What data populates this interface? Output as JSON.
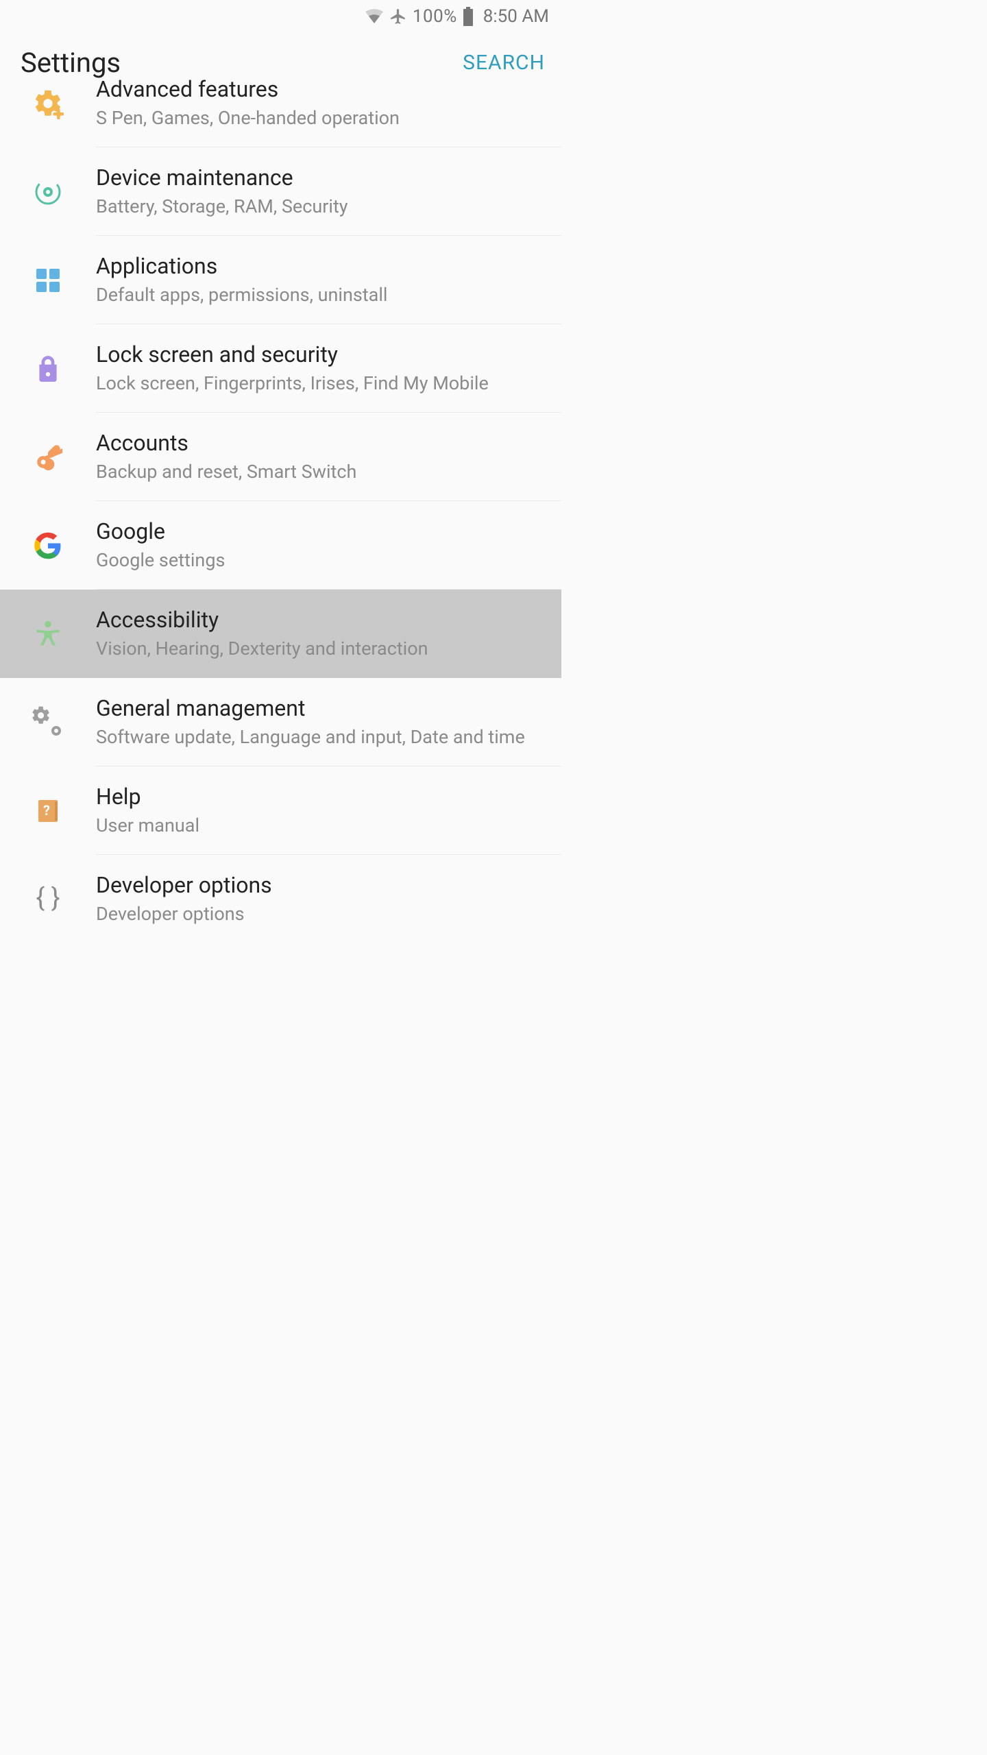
{
  "statusbar": {
    "battery_pct": "100%",
    "time": "8:50 AM"
  },
  "appbar": {
    "title": "Settings",
    "search_label": "SEARCH"
  },
  "colors": {
    "accent_search": "#2f9dbf",
    "advanced_icon": "#f4b64e",
    "maintenance_icon": "#54c1a4",
    "apps_icon": "#61b3e4",
    "lock_icon": "#a88ee5",
    "accounts_icon": "#f49b5e",
    "google_icon": "#4a86e0",
    "accessibility_icon": "#8fd08e",
    "general_icon": "#9e9e9e",
    "help_icon": "#e9a661",
    "developer_icon": "#8a8a8a"
  },
  "items": {
    "advanced": {
      "title": "Advanced features",
      "sub": "S Pen, Games, One-handed operation"
    },
    "maintenance": {
      "title": "Device maintenance",
      "sub": "Battery, Storage, RAM, Security"
    },
    "apps": {
      "title": "Applications",
      "sub": "Default apps, permissions, uninstall"
    },
    "lock": {
      "title": "Lock screen and security",
      "sub": "Lock screen, Fingerprints, Irises, Find My Mobile"
    },
    "accounts": {
      "title": "Accounts",
      "sub": "Backup and reset, Smart Switch"
    },
    "google": {
      "title": "Google",
      "sub": "Google settings"
    },
    "accessibility": {
      "title": "Accessibility",
      "sub": "Vision, Hearing, Dexterity and interaction"
    },
    "general": {
      "title": "General management",
      "sub": "Software update, Language and input, Date and time"
    },
    "help": {
      "title": "Help",
      "sub": "User manual"
    },
    "developer": {
      "title": "Developer options",
      "sub": "Developer options"
    }
  }
}
